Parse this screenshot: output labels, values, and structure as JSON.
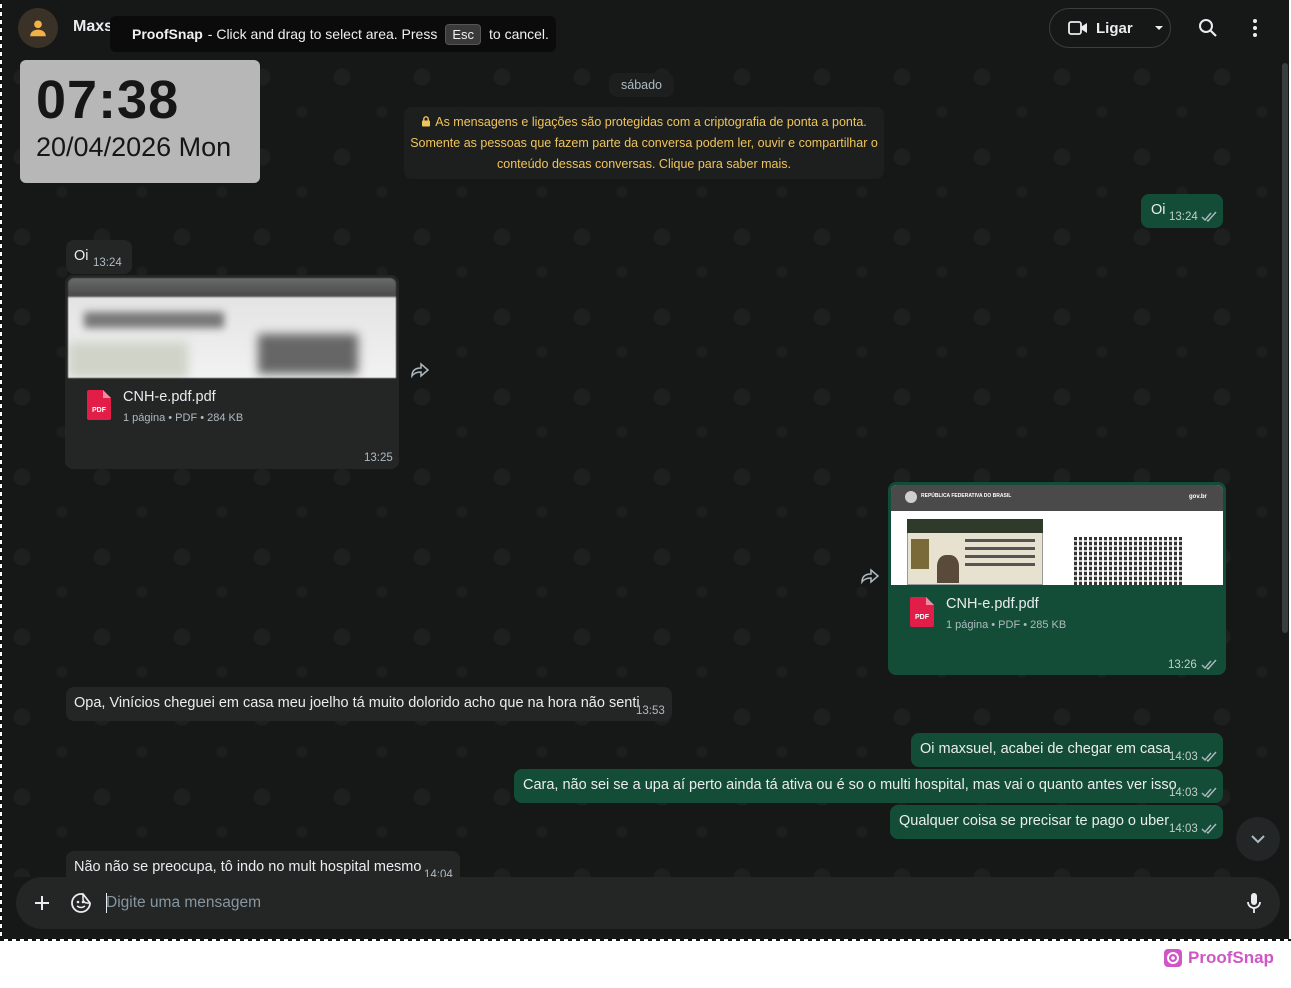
{
  "header": {
    "contact_name": "Maxsuel Amorim",
    "call_label": "Ligar"
  },
  "proofsnap": {
    "brand": "ProofSnap",
    "instruction": "- Click and drag to select area. Press",
    "key": "Esc",
    "suffix": "to cancel.",
    "watermark": "ProofSnap"
  },
  "clock": {
    "time": "07:38",
    "date": "20/04/2026 Mon"
  },
  "chat": {
    "day_label": "sábado",
    "encryption_notice": "As mensagens e ligações são protegidas com a criptografia de ponta a ponta. Somente as pessoas que fazem parte da conversa podem ler, ouvir e compartilhar o conteúdo dessas conversas. Clique para saber mais.",
    "messages": [
      {
        "direction": "out",
        "text": "Oi",
        "time": "13:24",
        "status": "read"
      },
      {
        "direction": "in",
        "text": "Oi",
        "time": "13:24"
      },
      {
        "direction": "in",
        "type": "document",
        "file_name": "CNH-e.pdf.pdf",
        "meta": "1 página • PDF • 284 KB",
        "file_type": "PDF",
        "time": "13:25"
      },
      {
        "direction": "out",
        "type": "document",
        "file_name": "CNH-e.pdf.pdf",
        "meta": "1 página • PDF • 285 KB",
        "file_type": "PDF",
        "time": "13:26",
        "status": "read",
        "preview_header": "REPÚBLICA FEDERATIVA DO BRASIL",
        "preview_brand": "gov.br"
      },
      {
        "direction": "in",
        "text": "Opa, Vinícios cheguei em casa meu joelho tá muito dolorido acho que na hora não senti",
        "time": "13:53"
      },
      {
        "direction": "out",
        "text": "Oi maxsuel, acabei de chegar em casa",
        "time": "14:03",
        "status": "read"
      },
      {
        "direction": "out",
        "text": "Cara, não sei se a upa aí perto ainda tá ativa ou é so o multi hospital, mas vai o quanto antes ver isso",
        "time": "14:03",
        "status": "read"
      },
      {
        "direction": "out",
        "text": "Qualquer coisa se precisar te pago o uber",
        "time": "14:03",
        "status": "read"
      },
      {
        "direction": "in",
        "text": "Não não se preocupa, tô indo no mult hospital mesmo",
        "time": "14:04"
      }
    ]
  },
  "composer": {
    "placeholder": "Digite uma mensagem"
  },
  "icons": {
    "avatar": "person-icon",
    "video": "video-icon",
    "dropdown": "chevron-down-icon",
    "search": "search-icon",
    "menu": "more-vertical-icon",
    "lock": "lock-icon",
    "forward": "forward-icon",
    "read": "double-check-icon",
    "attach": "plus-icon",
    "sticker": "sticker-icon",
    "mic": "mic-icon",
    "scroll": "chevron-down-icon"
  },
  "colors": {
    "background": "#161717",
    "incoming_bubble": "#242626",
    "outgoing_bubble": "#144d37",
    "notice_text": "#f0c45a",
    "pdf_red": "#e11d48",
    "watermark": "#d056c6"
  }
}
